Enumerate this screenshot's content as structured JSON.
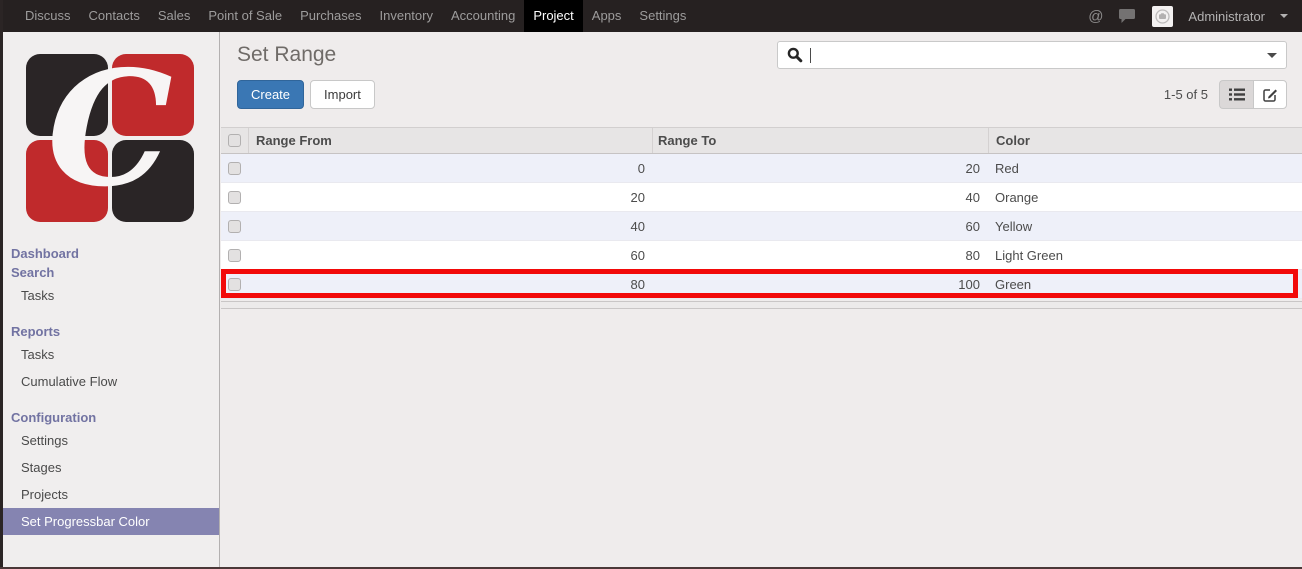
{
  "topnav": {
    "items": [
      "Discuss",
      "Contacts",
      "Sales",
      "Point of Sale",
      "Purchases",
      "Inventory",
      "Accounting",
      "Project",
      "Apps",
      "Settings"
    ],
    "active_item": "Project",
    "icons": {
      "mention": "@",
      "chat": "speech-bubble",
      "avatar": "camera-placeholder",
      "user_dropdown": "caret-down"
    },
    "user": {
      "name": "Administrator"
    }
  },
  "sidebar": {
    "logo": {
      "letter": "C"
    },
    "menu": [
      {
        "label": "Dashboard",
        "type": "header"
      },
      {
        "label": "Search",
        "type": "header"
      },
      {
        "label": "Tasks",
        "type": "item"
      },
      {
        "label": "Reports",
        "type": "header"
      },
      {
        "label": "Tasks",
        "type": "item"
      },
      {
        "label": "Cumulative Flow",
        "type": "item"
      },
      {
        "label": "Configuration",
        "type": "header"
      },
      {
        "label": "Settings",
        "type": "item"
      },
      {
        "label": "Stages",
        "type": "item"
      },
      {
        "label": "Projects",
        "type": "item"
      },
      {
        "label": "Set Progressbar Color",
        "type": "item",
        "selected": true
      }
    ]
  },
  "content": {
    "title": "Set Range",
    "buttons": {
      "create": "Create",
      "import": "Import"
    },
    "search": {
      "value": "",
      "placeholder": ""
    },
    "pager": {
      "label": "1-5 of 5"
    },
    "view_switcher": {
      "active": "list",
      "views": [
        "list",
        "form"
      ]
    },
    "table": {
      "columns": [
        "Range From",
        "Range To",
        "Color"
      ],
      "rows": [
        {
          "range_from": "0",
          "range_to": "20",
          "color": "Red"
        },
        {
          "range_from": "20",
          "range_to": "40",
          "color": "Orange"
        },
        {
          "range_from": "40",
          "range_to": "60",
          "color": "Yellow"
        },
        {
          "range_from": "60",
          "range_to": "80",
          "color": "Light Green"
        },
        {
          "range_from": "80",
          "range_to": "100",
          "color": "Green",
          "annotated": true
        }
      ]
    },
    "annotation": {
      "highlighted_row_index": 4,
      "color": "#f20a0a"
    }
  },
  "colors": {
    "topnav_bg": "#262121",
    "topnav_active_bg": "#000000",
    "accent_blue": "#3a77b4",
    "sidebar_selected": "#8584b1",
    "row_stripe": "#eef0f9",
    "logo_red": "#c02a2c",
    "logo_black": "#2a2526",
    "annotation_red": "#f20a0a"
  }
}
